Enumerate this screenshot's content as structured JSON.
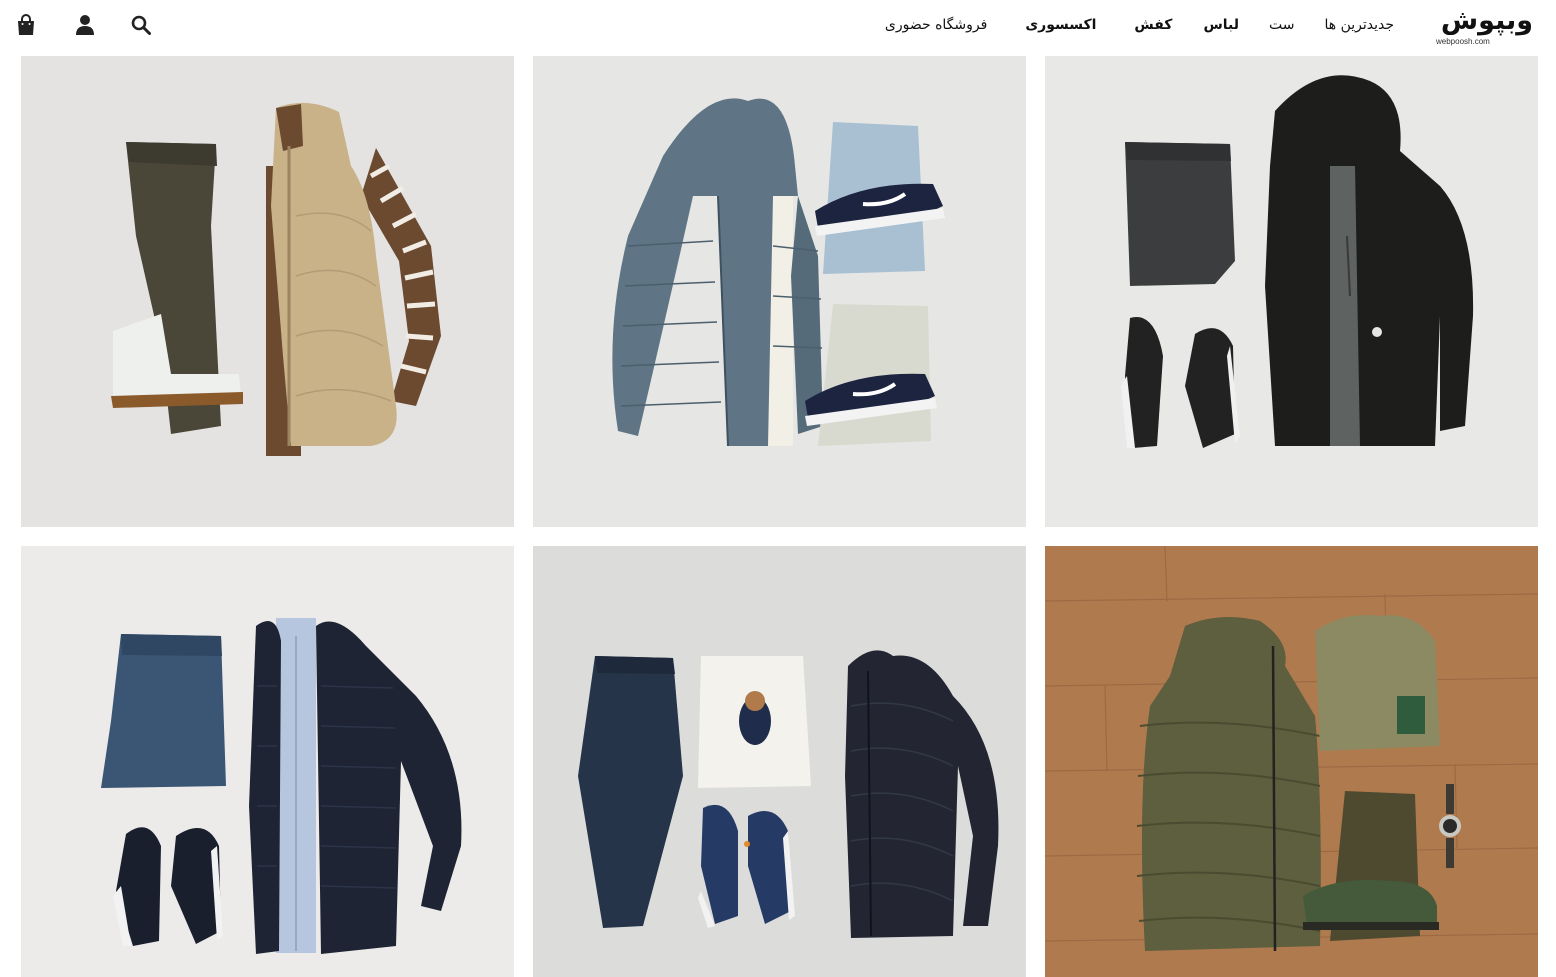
{
  "header": {
    "logo": {
      "text": "وبپوش",
      "url": "webpoosh.com"
    },
    "nav": [
      {
        "label": "جدیدترین ها",
        "bold": false
      },
      {
        "label": "ست",
        "bold": false
      },
      {
        "label": "لباس",
        "bold": true
      },
      {
        "label": "کفش",
        "bold": true
      },
      {
        "label": "اکسسوری",
        "bold": true
      },
      {
        "label": "فروشگاه حضوری",
        "bold": false
      }
    ],
    "icons": [
      "search-icon",
      "user-icon",
      "shopping-bag-icon"
    ]
  },
  "colors": {
    "text": "#111111",
    "background": "#ffffff",
    "photo_bg_light": "#e6e5e3",
    "photo_bg_wood": "#b07a4f"
  },
  "outfits": [
    {
      "name": "outfit-beige-vest-striped-sweater"
    },
    {
      "name": "outfit-blue-puffer-jacket-sneakers"
    },
    {
      "name": "outfit-black-hooded-jacket"
    },
    {
      "name": "outfit-navy-quilted-jacket-jeans"
    },
    {
      "name": "outfit-navy-puffer-bear-sweatshirt"
    },
    {
      "name": "outfit-olive-puffer-vest-wood"
    }
  ]
}
